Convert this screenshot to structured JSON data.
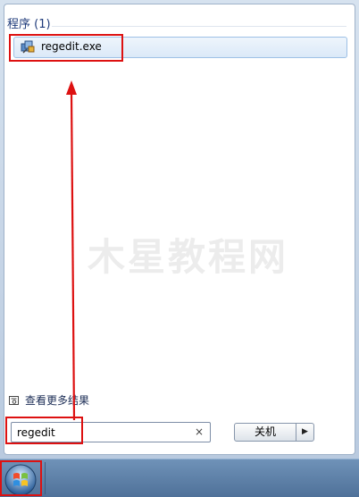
{
  "start_menu": {
    "programs_header": "程序 (1)",
    "result_item": {
      "label": "regedit.exe",
      "icon": "regedit-icon"
    },
    "watermark": "木星教程网",
    "see_more_label": "查看更多结果",
    "search": {
      "value": "regedit",
      "clear_icon": "×"
    },
    "shutdown_label": "关机",
    "shutdown_arrow": "▶"
  },
  "annotations": {
    "highlight_color": "#dd1111"
  }
}
